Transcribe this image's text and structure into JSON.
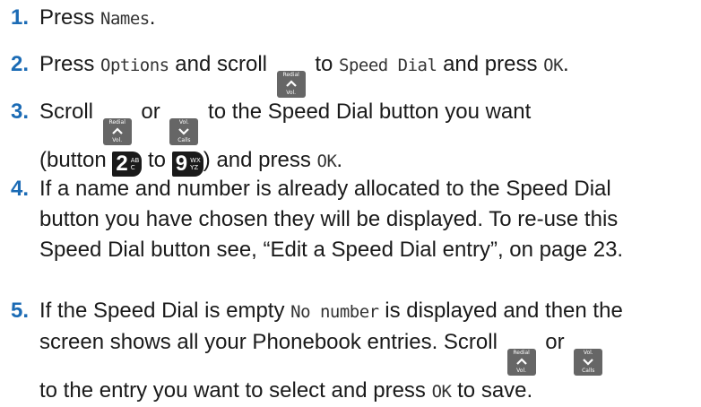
{
  "steps": [
    {
      "num": "1.",
      "t1": "Press ",
      "lcd1": "Names",
      "t2": "."
    },
    {
      "num": "2.",
      "t1": "Press ",
      "lcd1": "Options",
      "t2": " and scroll ",
      "t3": " to ",
      "lcd2": "Speed Dial",
      "t4": " and press ",
      "lcd3": "OK",
      "t5": "."
    },
    {
      "num": "3.",
      "t1": "Scroll ",
      "t2": " or ",
      "t3": " to the Speed Dial button you want",
      "t4": "(button ",
      "t5": " to ",
      "t6": ") and press ",
      "lcd1": "OK",
      "t7": "."
    },
    {
      "num": "4.",
      "line1": "If a name and number is already allocated to the Speed Dial",
      "line2": "button you have chosen they will be displayed. To re-use this",
      "line3": "Speed Dial button see, “Edit a Speed Dial entry”, on page 23."
    },
    {
      "num": "5.",
      "t1": "If the Speed Dial is empty ",
      "lcd1": "No number",
      "t2": " is displayed and then the",
      "t3": "screen shows all your Phonebook entries. Scroll ",
      "t4": " or ",
      "t5": "to the entry you want to select and press ",
      "lcd2": "OK",
      "t6": " to save."
    }
  ],
  "keys": {
    "redial": {
      "top": "Redial",
      "bottom": "Vol."
    },
    "calls": {
      "top": "Vol.",
      "bottom": "Calls"
    },
    "two": {
      "digit": "2",
      "l1": "AB",
      "l2": "C"
    },
    "nine": {
      "digit": "9",
      "l1": "WX",
      "l2": "YZ"
    }
  },
  "colors": {
    "step_number": "#1b6bb5",
    "key_grey": "#666666"
  }
}
